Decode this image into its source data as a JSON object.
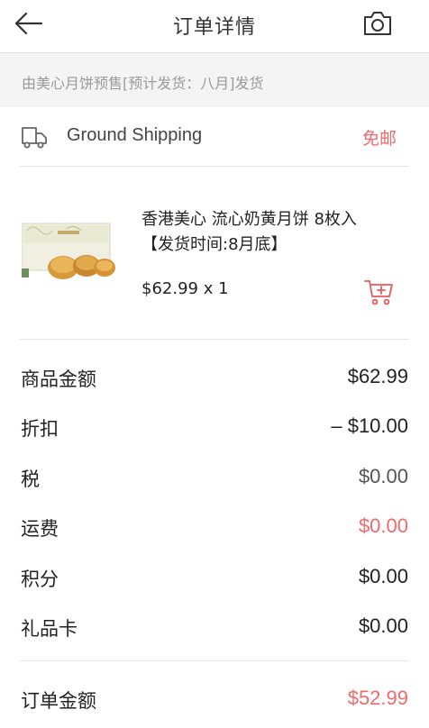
{
  "header": {
    "title": "订单详情",
    "back_icon": "arrow-left-icon",
    "camera_icon": "camera-icon"
  },
  "notice": {
    "text": "由美心月饼预售[预计发货：八月]发货"
  },
  "shipping": {
    "icon": "truck-icon",
    "method": "Ground Shipping",
    "price": "免邮"
  },
  "product": {
    "title": "香港美心 流心奶黄月饼 8枚入 【发货时间:8月底】",
    "price_qty": "$62.99 x 1",
    "cart_icon": "add-to-cart-icon"
  },
  "summary": [
    {
      "label": "商品金额",
      "value": "$62.99"
    },
    {
      "label": "折扣",
      "value": "– $10.00"
    },
    {
      "label": "税",
      "value": "$0.00"
    },
    {
      "label": "运费",
      "value": "$0.00"
    },
    {
      "label": "积分",
      "value": "$0.00"
    },
    {
      "label": "礼品卡",
      "value": "$0.00"
    }
  ],
  "total": {
    "label": "订单金额",
    "value": "$52.99"
  },
  "colors": {
    "accent": "#f06a6a",
    "notice_bg": "#f4f4f4",
    "divider": "#e6e6e6"
  }
}
